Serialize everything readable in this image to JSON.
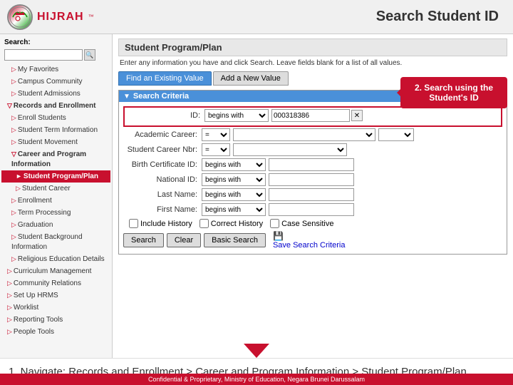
{
  "header": {
    "logo_text": "HIJRAH",
    "logo_tm": "™",
    "page_title": "Search Student ID"
  },
  "sidebar": {
    "search_label": "Search:",
    "search_placeholder": "",
    "items": [
      {
        "label": "My Favorites",
        "level": 1,
        "active": false
      },
      {
        "label": "Campus Community",
        "level": 1,
        "active": false
      },
      {
        "label": "Student Admissions",
        "level": 1,
        "active": false
      },
      {
        "label": "Records and Enrollment",
        "level": 0,
        "active": false,
        "header": true
      },
      {
        "label": "Enroll Students",
        "level": 1,
        "active": false
      },
      {
        "label": "Student Term Information",
        "level": 1,
        "active": false
      },
      {
        "label": "Student Movement",
        "level": 1,
        "active": false
      },
      {
        "label": "Career and Program Information",
        "level": 1,
        "active": false,
        "header": true
      },
      {
        "label": "Student Program/Plan",
        "level": 2,
        "active": true
      },
      {
        "label": "Student Career",
        "level": 2,
        "active": false
      },
      {
        "label": "Enrollment",
        "level": 1,
        "active": false
      },
      {
        "label": "Term Processing",
        "level": 1,
        "active": false
      },
      {
        "label": "Graduation",
        "level": 1,
        "active": false
      },
      {
        "label": "Student Background Information",
        "level": 1,
        "active": false
      },
      {
        "label": "Religious Education Details",
        "level": 1,
        "active": false
      },
      {
        "label": "Curriculum Management",
        "level": 0,
        "active": false
      },
      {
        "label": "Community Relations",
        "level": 0,
        "active": false
      },
      {
        "label": "Set Up HRMS",
        "level": 0,
        "active": false
      },
      {
        "label": "Worklist",
        "level": 0,
        "active": false
      },
      {
        "label": "Reporting Tools",
        "level": 0,
        "active": false
      },
      {
        "label": "People Tools",
        "level": 0,
        "active": false
      }
    ]
  },
  "content": {
    "panel_title": "Student Program/Plan",
    "panel_desc": "Enter any information you have and click Search. Leave fields blank for a list of all values.",
    "tab_find": "Find an Existing Value",
    "tab_add": "Add a New Value",
    "criteria_title": "Search Criteria",
    "callout_text": "2. Search using the Student's ID",
    "fields": {
      "id_label": "ID:",
      "id_operator": "begins with",
      "id_value": "000318386",
      "academic_career_label": "Academic Career:",
      "academic_career_operator": "=",
      "student_career_nbr_label": "Student Career Nbr:",
      "student_career_nbr_operator": "=",
      "birth_cert_label": "Birth Certificate ID:",
      "birth_cert_operator": "begins with",
      "national_id_label": "National ID:",
      "national_id_operator": "begins with",
      "last_name_label": "Last Name:",
      "last_name_operator": "begins with",
      "first_name_label": "First Name:",
      "first_name_operator": "begins with"
    },
    "checkboxes": {
      "include_history": "Include History",
      "correct_history": "Correct History",
      "case_sensitive": "Case Sensitive"
    },
    "buttons": {
      "search": "Search",
      "clear": "Clear",
      "basic_search": "Basic Search",
      "save_search": "Save Search Criteria"
    }
  },
  "bottom_nav": {
    "text": "1. Navigate: Records and Enrollment > Career and Program Information > Student Program/Plan"
  },
  "footer": {
    "text": "Confidential & Proprietary, Ministry of Education, Negara Brunei Darussalam"
  }
}
